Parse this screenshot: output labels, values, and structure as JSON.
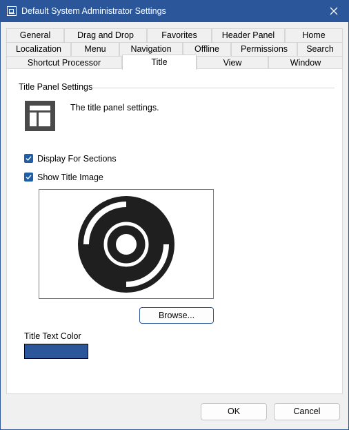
{
  "window": {
    "title": "Default System Administrator Settings"
  },
  "tabs": {
    "row1": [
      "General",
      "Drag and Drop",
      "Favorites",
      "Header Panel",
      "Home"
    ],
    "row2": [
      "Localization",
      "Menu",
      "Navigation",
      "Offline",
      "Permissions",
      "Search"
    ],
    "row3": [
      "Shortcut Processor",
      "Title",
      "View",
      "Window"
    ],
    "selected": "Title"
  },
  "panel": {
    "group_title": "Title Panel Settings",
    "description": "The title panel settings.",
    "display_for_sections": {
      "label": "Display For Sections",
      "checked": true
    },
    "show_title_image": {
      "label": "Show Title Image",
      "checked": true
    },
    "browse_label": "Browse...",
    "title_text_color": {
      "label": "Title Text Color",
      "value": "#2b579a"
    }
  },
  "footer": {
    "ok_label": "OK",
    "cancel_label": "Cancel"
  },
  "icons": {
    "app": "settings-window-icon",
    "close": "close-icon",
    "panel": "title-panel-layout-icon",
    "preview": "title-image-disc-icon"
  }
}
